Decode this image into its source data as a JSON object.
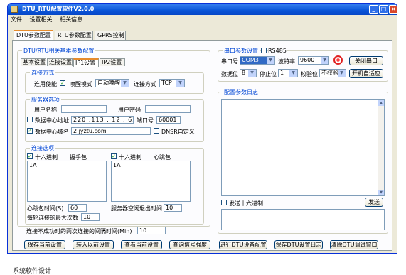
{
  "window": {
    "title": "DTU_RTU配置软件V2.0.0"
  },
  "menu": [
    "文件",
    "设置相关",
    "相关信息"
  ],
  "tabs": [
    "DTU参数配置",
    "RTU参数配置",
    "GPRS控制"
  ],
  "left": {
    "group_title": "DTU/RTU相关基本参数配置",
    "subtabs": [
      "基本设置",
      "连接设置",
      "IP1设置",
      "IP2设置"
    ],
    "conn": {
      "title": "连接方式",
      "use_ip_label": "连用使能",
      "wake_label": "唤醒模式",
      "wake_value": "自动唤醒",
      "mode_label": "连接方式",
      "mode_value": "TCP"
    },
    "server": {
      "title": "服务器选项",
      "user_label": "用户名称",
      "pass_label": "用户密码",
      "ip_label": "数据中心地址",
      "ip": [
        "220",
        ".",
        "113",
        ".",
        "12",
        ".",
        "62"
      ],
      "port_label": "端口号",
      "port": "60001",
      "domain_label": "数据中心域名",
      "domain": "2.jyztu.com",
      "dnsr_label": "DNSR自定义"
    },
    "link": {
      "title": "连接选项",
      "hex1_label": "十六进制",
      "hb_label": "握手包",
      "hb_value": "1A",
      "hex2_label": "十六进制",
      "beat_label": "心跳包",
      "beat_value": "1A",
      "beat_time_label": "心跳包时间(S)",
      "beat_time": "60",
      "idle_label": "服务器空闲退出时间",
      "idle": "10",
      "retry_label": "每轮连接的最大次数",
      "retry": "10",
      "interval_label": "连接不成功时的两次连接的间隔时间(Min)",
      "interval": "10"
    }
  },
  "serial": {
    "title": "串口参数设置",
    "rs485": "RS485",
    "port_label": "串口号",
    "port": "COM3",
    "baud_label": "波特率",
    "baud": "9600",
    "open_btn": "关闭串口",
    "data_label": "数据位",
    "data": "8",
    "stop_label": "停止位",
    "stop": "1",
    "parity_label": "校验位",
    "parity": "不校验",
    "auto_btn": "开机自适应"
  },
  "log": {
    "title": "配置参数日志",
    "hex_send": "发送十六进制",
    "send_btn": "发送"
  },
  "bottom": [
    "保存当前设置",
    "装入以前设置",
    "查看当前设置",
    "查询信号强度",
    "进行DTU设备配置",
    "保存DTU设置日志",
    "清除DTU调试窗口"
  ],
  "caption": "系统软件设计"
}
